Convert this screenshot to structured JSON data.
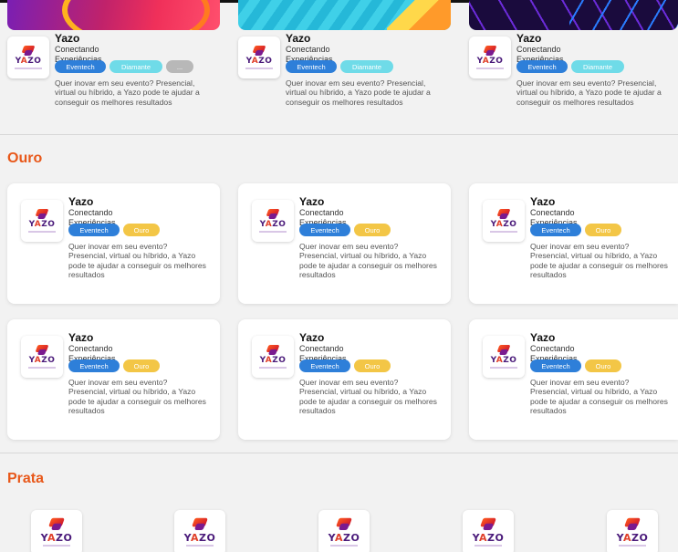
{
  "diamond": {
    "cards": [
      {
        "name": "Yazo",
        "tagline": "Conectando Experiências",
        "tags": [
          "Eventech",
          "Diamante",
          "..."
        ],
        "description": "Quer inovar em seu evento? Presencial, virtual ou híbrido, a Yazo pode te ajudar a conseguir os melhores resultados"
      },
      {
        "name": "Yazo",
        "tagline": "Conectando Experiências",
        "tags": [
          "Eventech",
          "Diamante"
        ],
        "description": "Quer inovar em seu evento? Presencial, virtual ou híbrido, a Yazo pode te ajudar a conseguir os melhores resultados"
      },
      {
        "name": "Yazo",
        "tagline": "Conectando Experiências",
        "tags": [
          "Eventech",
          "Diamante"
        ],
        "description": "Quer inovar em seu evento? Presencial, virtual ou híbrido, a Yazo pode te ajudar a conseguir os melhores resultados"
      }
    ]
  },
  "ouro": {
    "title": "Ouro",
    "cards": [
      {
        "name": "Yazo",
        "tagline": "Conectando Experiências",
        "tags": [
          "Eventech",
          "Ouro"
        ],
        "description": "Quer inovar em seu evento? Presencial, virtual ou híbrido, a Yazo pode te ajudar a conseguir os melhores resultados"
      },
      {
        "name": "Yazo",
        "tagline": "Conectando Experiências",
        "tags": [
          "Eventech",
          "Ouro"
        ],
        "description": "Quer inovar em seu evento? Presencial, virtual ou híbrido, a Yazo pode te ajudar a conseguir os melhores resultados"
      },
      {
        "name": "Yazo",
        "tagline": "Conectando Experiências",
        "tags": [
          "Eventech",
          "Ouro"
        ],
        "description": "Quer inovar em seu evento? Presencial, virtual ou híbrido, a Yazo pode te ajudar a conseguir os melhores resultados"
      },
      {
        "name": "Yazo",
        "tagline": "Conectando Experiências",
        "tags": [
          "Eventech",
          "Ouro"
        ],
        "description": "Quer inovar em seu evento? Presencial, virtual ou híbrido, a Yazo pode te ajudar a conseguir os melhores resultados"
      },
      {
        "name": "Yazo",
        "tagline": "Conectando Experiências",
        "tags": [
          "Eventech",
          "Ouro"
        ],
        "description": "Quer inovar em seu evento? Presencial, virtual ou híbrido, a Yazo pode te ajudar a conseguir os melhores resultados"
      },
      {
        "name": "Yazo",
        "tagline": "Conectando Experiências",
        "tags": [
          "Eventech",
          "Ouro"
        ],
        "description": "Quer inovar em seu evento? Presencial, virtual ou híbrido, a Yazo pode te ajudar a conseguir os melhores resultados"
      }
    ]
  },
  "prata": {
    "title": "Prata",
    "logo_count": 5
  },
  "logo": {
    "text_pre": "Y",
    "text_a": "A",
    "text_post": "ZO"
  },
  "colors": {
    "section_title": "#e8581a",
    "eventech": "#2e7fd9",
    "diamante": "#6fdbe8",
    "ouro": "#f3c646",
    "more": "#b8b8b8"
  },
  "icons": {
    "logo": "yazo-logo-icon"
  }
}
